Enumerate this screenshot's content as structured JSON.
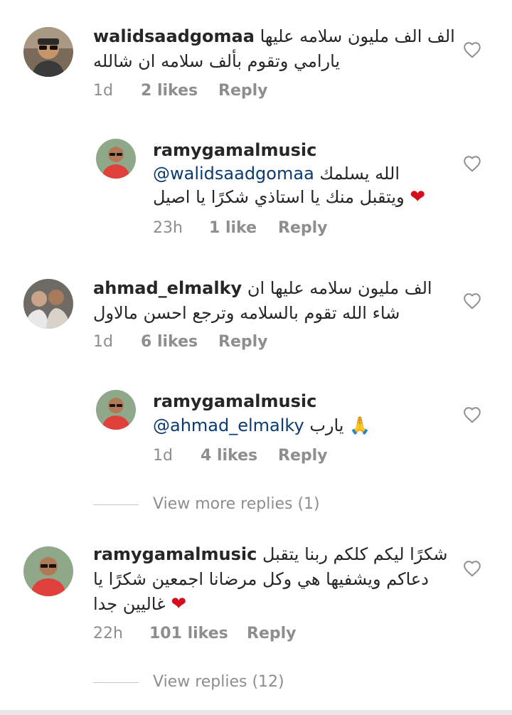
{
  "comments": [
    {
      "username": "walidsaadgomaa",
      "text_line1": "الف الف مليون سلامه عليها",
      "text_line2": "يارامي وتقوم بألف سلامه ان شالله",
      "time": "1d",
      "likes": "2 likes",
      "reply": "Reply",
      "avatar_icon": "profile-photo-man-sunglasses"
    },
    {
      "username": "ramygamalmusic",
      "mention": "@walidsaadgomaa",
      "text_line1": "الله يسلمك",
      "text_line2": "ويتقبل منك يا استاذي شكرًا يا اصيل",
      "emoji": "❤",
      "time": "23h",
      "likes": "1 like",
      "reply": "Reply",
      "avatar_icon": "profile-photo-man-red-shirt"
    },
    {
      "username": "ahmad_elmalky",
      "text_line1": "الف مليون سلامه عليها ان",
      "text_line2": "شاء الله تقوم بالسلامه وترجع احسن مالاول",
      "time": "1d",
      "likes": "6 likes",
      "reply": "Reply",
      "avatar_icon": "profile-photo-two-men"
    },
    {
      "username": "ramygamalmusic",
      "mention": "@ahmad_elmalky",
      "text_line1": "يارب",
      "emoji": "🙏",
      "time": "1d",
      "likes": "4 likes",
      "reply": "Reply",
      "avatar_icon": "profile-photo-man-red-shirt"
    },
    {
      "username": "ramygamalmusic",
      "text_line1": "شكرًا ليكم كلكم ربنا يتقبل",
      "text_line2": "دعاكم ويشفيها هي وكل مرضانا اجمعين شكرًا يا",
      "text_line3": "غاليين جدا",
      "emoji": "❤",
      "time": "22h",
      "likes": "101 likes",
      "reply": "Reply",
      "avatar_icon": "profile-photo-man-red-shirt"
    }
  ],
  "view_more_replies": "View more replies (1)",
  "view_replies": "View replies (12)",
  "colors": {
    "text": "#262626",
    "meta": "#8e8e8e",
    "mention": "#0b3b72",
    "heart_emoji": "#d40f1d"
  }
}
